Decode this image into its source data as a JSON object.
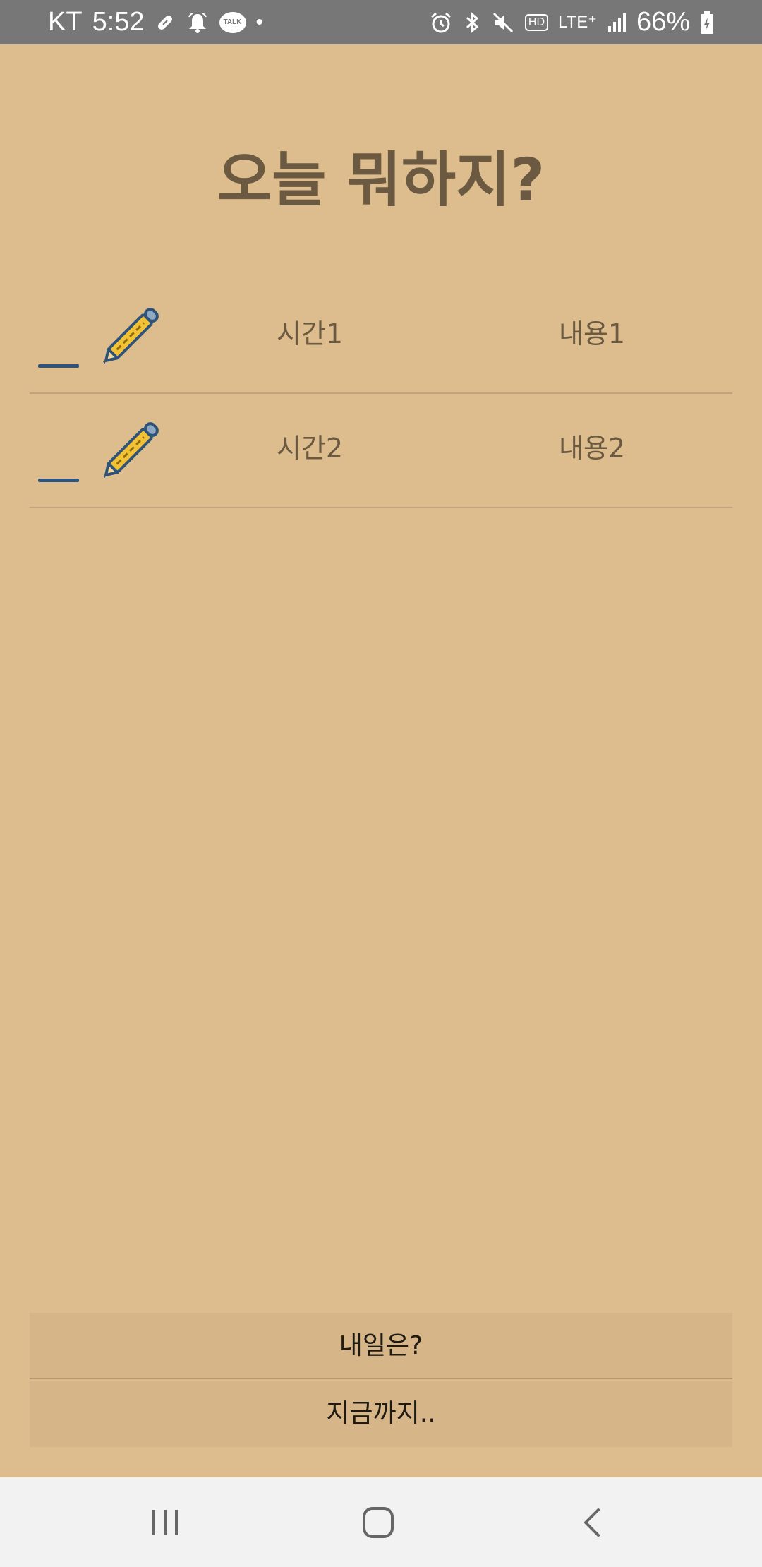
{
  "status_bar": {
    "carrier": "KT",
    "time": "5:52",
    "talk_badge": "TALK",
    "dot": "•",
    "hd_badge": "HD",
    "network": "LTE⁺",
    "battery": "66%"
  },
  "screen": {
    "title": "오늘 뭐하지?"
  },
  "todo_list": [
    {
      "time": "시간1",
      "content": "내용1"
    },
    {
      "time": "시간2",
      "content": "내용2"
    }
  ],
  "buttons": {
    "tomorrow": "내일은?",
    "history": "지금까지.."
  },
  "colors": {
    "background": "#DDBD8E",
    "title_text": "#6B5A41",
    "check_line": "#2D5381",
    "button_bg": "#D6B689",
    "status_bar": "#777777",
    "nav_bar": "#F2F2F2"
  },
  "icons": {
    "row_edit": "pencil-icon",
    "row_check": "check-line-icon",
    "nav_recents": "recents-icon",
    "nav_home": "home-icon",
    "nav_back": "back-icon"
  }
}
